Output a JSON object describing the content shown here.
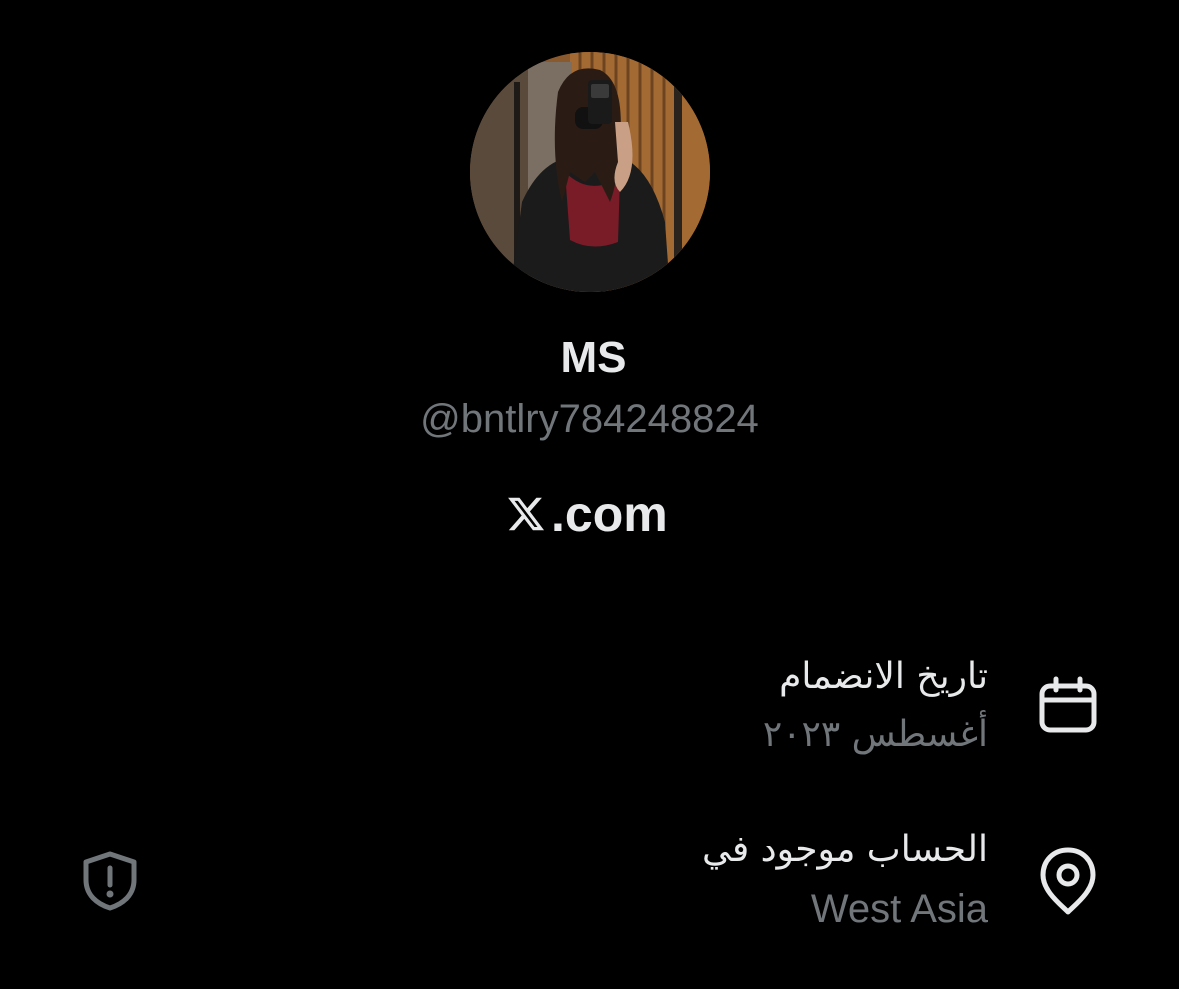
{
  "profile": {
    "display_name": "MS",
    "handle": "@bntlry784248824",
    "website": ".com",
    "avatar_icon": "profile-avatar-photo"
  },
  "about": {
    "joined": {
      "title": "تاريخ الانضمام",
      "value": "أغسطس ٢٠٢٣",
      "icon": "calendar-icon"
    },
    "location": {
      "title": "الحساب موجود في",
      "value": "West Asia",
      "icon": "location-pin-icon"
    },
    "safety_icon": "shield-alert-icon"
  },
  "colors": {
    "background": "#000000",
    "primary_text": "#e7e9ea",
    "secondary_text": "#71767b"
  }
}
